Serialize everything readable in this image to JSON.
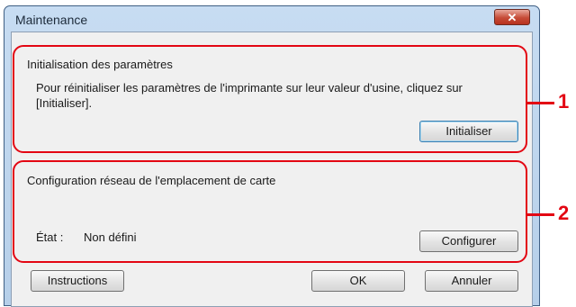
{
  "window": {
    "title": "Maintenance",
    "close_label": "✕"
  },
  "section1": {
    "heading": "Initialisation des paramètres",
    "description_line1": "Pour réinitialiser les paramètres de l'imprimante sur leur valeur d'usine, cliquez sur",
    "description_line2": "[Initialiser].",
    "button_label": "Initialiser"
  },
  "section2": {
    "heading": "Configuration réseau de l'emplacement de carte",
    "status_label": "État :",
    "status_value": "Non défini",
    "button_label": "Configurer"
  },
  "footer": {
    "instructions_label": "Instructions",
    "ok_label": "OK",
    "cancel_label": "Annuler"
  },
  "callouts": [
    "1",
    "2"
  ],
  "colors": {
    "callout_red": "#e30613",
    "title_bar": "#c7dcf2",
    "dialog_bg": "#f0f0f0"
  }
}
